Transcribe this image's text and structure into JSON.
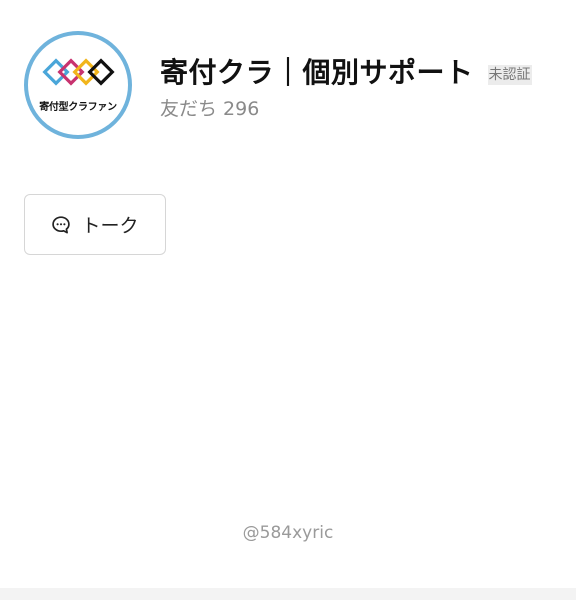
{
  "profile": {
    "avatar_text": "寄付型クラファン",
    "title": "寄付クラ｜個別サポート",
    "unverified_label": "未認証",
    "friends_label": "友だち",
    "friends_count": "296"
  },
  "actions": {
    "talk_label": "トーク",
    "talk_icon": "chat-bubble-icon"
  },
  "footer": {
    "line_id": "@584xyric"
  },
  "colors": {
    "avatar_ring": "#6fb3dc",
    "logo_blue": "#4aa6d9",
    "logo_magenta": "#c8336f",
    "logo_yellow": "#f1b51c",
    "logo_black": "#111111"
  }
}
